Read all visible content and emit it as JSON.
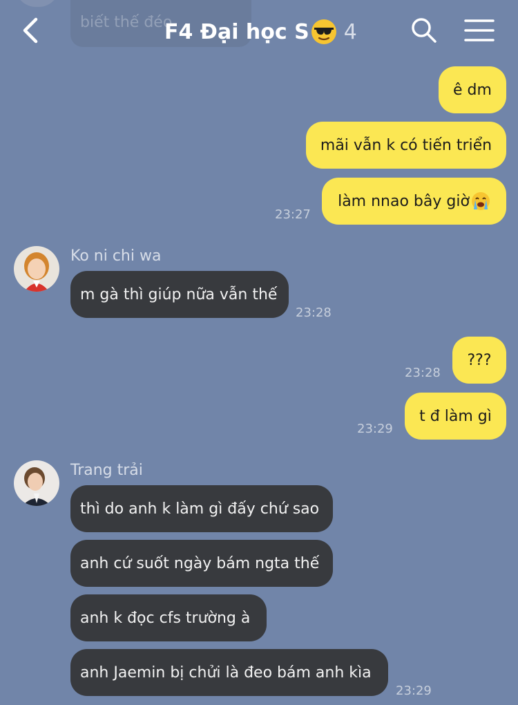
{
  "header": {
    "title": "F4 Đại học S",
    "member_count": "4",
    "faded_preview": "biết thế đéo"
  },
  "messages": [
    {
      "text": "ê dm"
    },
    {
      "text": "mãi vẫn k có tiến triển"
    },
    {
      "text": "làm nnao bây giờ",
      "time": "23:27"
    },
    {
      "sender": "Ko ni chi wa",
      "text": "m gà thì giúp nữa vẫn thế",
      "time": "23:28"
    },
    {
      "text": "???",
      "time": "23:28"
    },
    {
      "text": "t đ làm gì",
      "time": "23:29"
    },
    {
      "sender": "Trang trải",
      "text": "thì do anh k làm gì đấy chứ sao"
    },
    {
      "text": "anh cứ suốt ngày bám ngta thế"
    },
    {
      "text": "anh k đọc cfs trường à"
    },
    {
      "text": "anh Jaemin bị chửi là đeo bám anh kìa",
      "time": "23:29"
    }
  ],
  "icons": {
    "back": "chevron-left-icon",
    "search": "search-icon",
    "menu": "hamburger-menu-icon",
    "title_emoji": "sunglasses-emoji",
    "crying_emoji": "crying-face-emoji"
  },
  "colors": {
    "background": "#7185a9",
    "outgoing_bubble": "#fbe753",
    "incoming_bubble": "#383a3e"
  }
}
